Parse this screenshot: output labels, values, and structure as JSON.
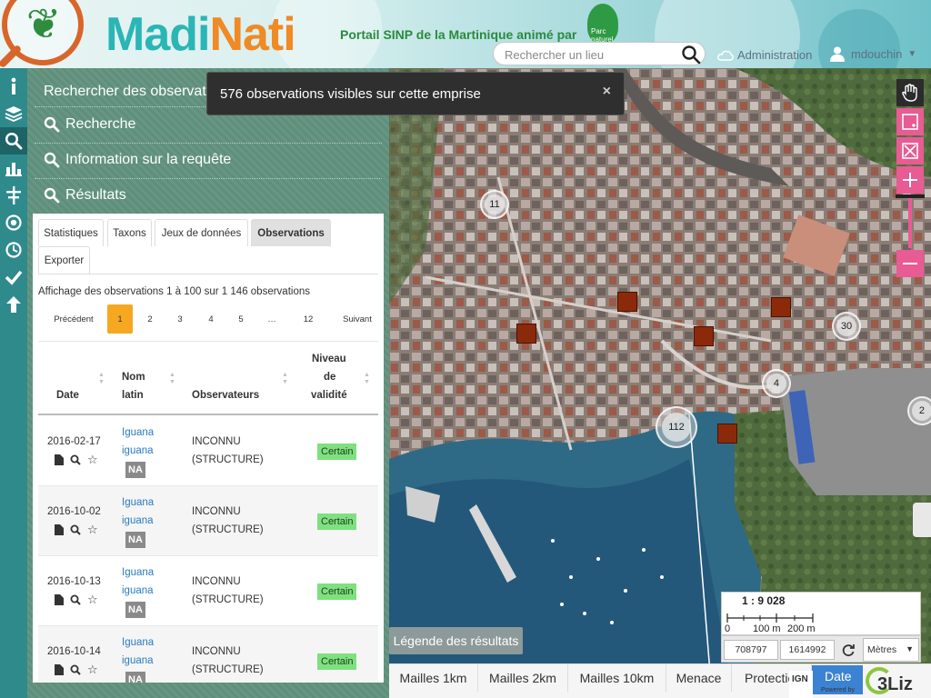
{
  "header": {
    "brand_part1": "Madi",
    "brand_part2": "Nati",
    "tagline": "Portail SINP de la Martinique animé par",
    "partner_logo_text": "Parc naturel",
    "search_placeholder": "Rechercher un lieu",
    "admin_label": "Administration",
    "user_label": "mdouchin"
  },
  "toolbar": {
    "icons": [
      "info-icon",
      "layers-icon",
      "search-icon",
      "chart-icon",
      "taxon-icon",
      "target-icon",
      "history-icon",
      "check-icon",
      "upload-icon"
    ],
    "active_index": 2
  },
  "panel": {
    "title": "Rechercher des observations",
    "sections": [
      "Recherche",
      "Information sur la requête",
      "Résultats"
    ]
  },
  "results": {
    "tabs": [
      "Statistiques",
      "Taxons",
      "Jeux de données",
      "Observations",
      "Exporter"
    ],
    "active_tab": "Observations",
    "summary": "Affichage des observations 1 à 100 sur 1 146 observations",
    "pagination": {
      "prev": "Précédent",
      "pages": [
        "1",
        "2",
        "3",
        "4",
        "5",
        "…",
        "12"
      ],
      "next": "Suivant",
      "current": "1"
    },
    "columns": {
      "date": "Date",
      "latin_line1": "Nom",
      "latin_line2": "latin",
      "observers": "Observateurs",
      "validity_line1": "Niveau",
      "validity_line2": "de",
      "validity_line3": "validité"
    },
    "rows": [
      {
        "date": "2016-02-17",
        "latin_1": "Iguana",
        "latin_2": "iguana",
        "status": "NA",
        "observer_1": "INCONNU",
        "observer_2": "(STRUCTURE)",
        "validity": "Certain"
      },
      {
        "date": "2016-10-02",
        "latin_1": "Iguana",
        "latin_2": "iguana",
        "status": "NA",
        "observer_1": "INCONNU",
        "observer_2": "(STRUCTURE)",
        "validity": "Certain"
      },
      {
        "date": "2016-10-13",
        "latin_1": "Iguana",
        "latin_2": "iguana",
        "status": "NA",
        "observer_1": "INCONNU",
        "observer_2": "(STRUCTURE)",
        "validity": "Certain"
      },
      {
        "date": "2016-10-14",
        "latin_1": "Iguana",
        "latin_2": "iguana",
        "status": "NA",
        "observer_1": "INCONNU",
        "observer_2": "(STRUCTURE)",
        "validity": "Certain"
      }
    ]
  },
  "map": {
    "toast": "576 observations visibles sur cette emprise",
    "clusters": [
      "11",
      "30",
      "4",
      "112",
      "2"
    ],
    "legend_button": "Légende des résultats",
    "scale_ratio": "1 : 9 028",
    "scale_ticks": [
      "0",
      "100 m",
      "200 m"
    ],
    "coord_x": "708797",
    "coord_y": "1614992",
    "units": "Mètres",
    "bottom_tabs": [
      "Mailles 1km",
      "Mailles 2km",
      "Mailles 10km",
      "Menace",
      "Protection",
      "Date"
    ],
    "active_bottom_tab": "Date",
    "logo_ign": "IGN",
    "powered_by": "Powered by",
    "logo_3liz": "3Liz"
  },
  "colors": {
    "toolbar": "#2f8a8c",
    "accent_orange": "#f6a821",
    "map_control_pink": "#e85b93",
    "marker": "#8b2a0a",
    "validity_ok": "#7fe07f"
  }
}
